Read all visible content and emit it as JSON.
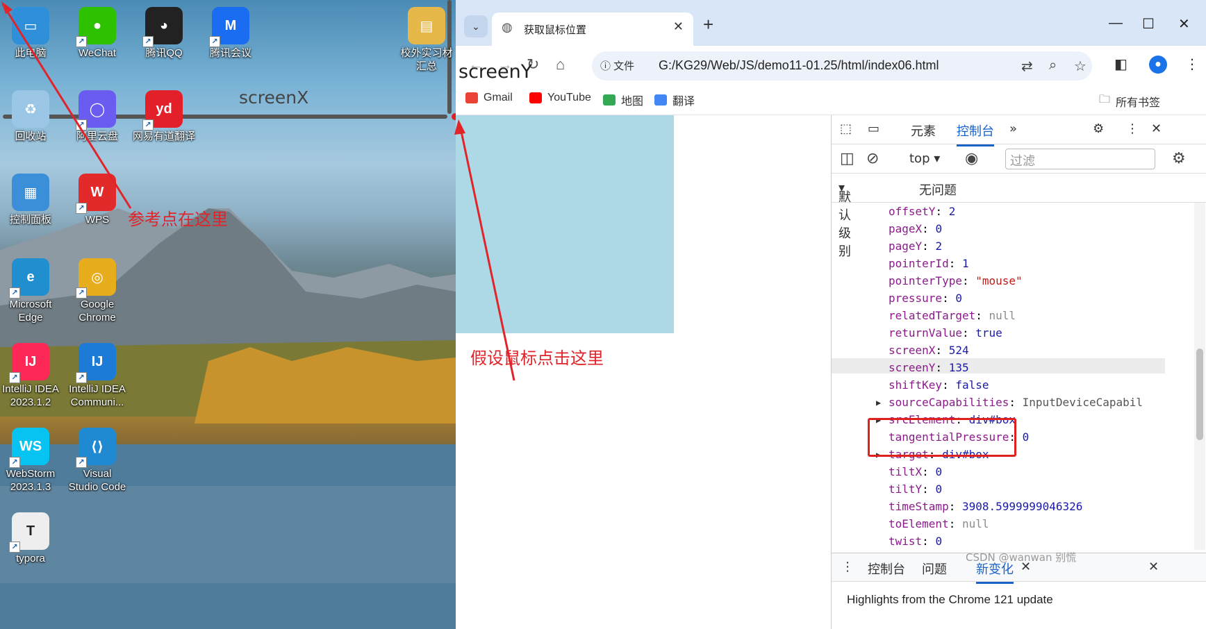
{
  "desktop": {
    "icons": [
      {
        "label": "此电脑",
        "icon": "computer-icon"
      },
      {
        "label": "WeChat",
        "icon": "wechat-icon"
      },
      {
        "label": "腾讯QQ",
        "icon": "qq-icon"
      },
      {
        "label": "腾讯会议",
        "icon": "tencent-meeting-icon"
      },
      {
        "label": "校外实习材\n汇总",
        "icon": "folder-icon"
      },
      {
        "label": "回收站",
        "icon": "recycle-bin-icon"
      },
      {
        "label": "阿里云盘",
        "icon": "aliyun-drive-icon"
      },
      {
        "label": "网易有道翻译",
        "icon": "youdao-icon"
      },
      {
        "label": "控制面板",
        "icon": "control-panel-icon"
      },
      {
        "label": "WPS",
        "icon": "wps-icon"
      },
      {
        "label": "Microsoft\nEdge",
        "icon": "edge-icon"
      },
      {
        "label": "Google\nChrome",
        "icon": "chrome-icon"
      },
      {
        "label": "IntelliJ IDEA\n2023.1.2",
        "icon": "intellij-icon"
      },
      {
        "label": "IntelliJ IDEA\nCommuni...",
        "icon": "intellij-community-icon"
      },
      {
        "label": "WebStorm\n2023.1.3",
        "icon": "webstorm-icon"
      },
      {
        "label": "Visual\nStudio Code",
        "icon": "vscode-icon"
      },
      {
        "label": "typora",
        "icon": "typora-icon"
      }
    ]
  },
  "annotations": {
    "screenX": "screenX",
    "screenY": "screenY",
    "reference": "参考点在这里",
    "click": "假设鼠标点击这里"
  },
  "browser": {
    "tab_title": "获取鼠标位置",
    "file_label": "文件",
    "url": "G:/KG29/Web/JS/demo11-01.25/html/index06.html",
    "bookmarks": [
      "Gmail",
      "YouTube",
      "地图",
      "翻译"
    ],
    "all_bookmarks": "所有书签"
  },
  "devtools": {
    "tabs": [
      "元素",
      "控制台"
    ],
    "active_tab": "控制台",
    "context": "top",
    "filter_placeholder": "过滤",
    "level": "默认级别",
    "issues": "无问题",
    "properties": [
      {
        "key": "offsetY",
        "value": "2",
        "type": "num"
      },
      {
        "key": "pageX",
        "value": "0",
        "type": "num"
      },
      {
        "key": "pageY",
        "value": "2",
        "type": "num"
      },
      {
        "key": "pointerId",
        "value": "1",
        "type": "num"
      },
      {
        "key": "pointerType",
        "value": "\"mouse\"",
        "type": "str"
      },
      {
        "key": "pressure",
        "value": "0",
        "type": "num"
      },
      {
        "key": "relatedTarget",
        "value": "null",
        "type": "nul"
      },
      {
        "key": "returnValue",
        "value": "true",
        "type": "num"
      },
      {
        "key": "screenX",
        "value": "524",
        "type": "num"
      },
      {
        "key": "screenY",
        "value": "135",
        "type": "num"
      },
      {
        "key": "shiftKey",
        "value": "false",
        "type": "num"
      },
      {
        "key": "sourceCapabilities",
        "value": "InputDeviceCapabil",
        "type": "obj",
        "expandable": true
      },
      {
        "key": "srcElement",
        "value": "div#box",
        "type": "num",
        "expandable": true
      },
      {
        "key": "tangentialPressure",
        "value": "0",
        "type": "num"
      },
      {
        "key": "target",
        "value": "div#box",
        "type": "num",
        "expandable": true
      },
      {
        "key": "tiltX",
        "value": "0",
        "type": "num"
      },
      {
        "key": "tiltY",
        "value": "0",
        "type": "num"
      },
      {
        "key": "timeStamp",
        "value": "3908.5999999046326",
        "type": "num"
      },
      {
        "key": "toElement",
        "value": "null",
        "type": "nul"
      },
      {
        "key": "twist",
        "value": "0",
        "type": "num"
      }
    ],
    "drawer_tabs": [
      "控制台",
      "问题",
      "新变化"
    ],
    "drawer_active": "新变化",
    "highlights": "Highlights from the Chrome 121 update"
  },
  "watermark": "CSDN @wanwan 别慌"
}
